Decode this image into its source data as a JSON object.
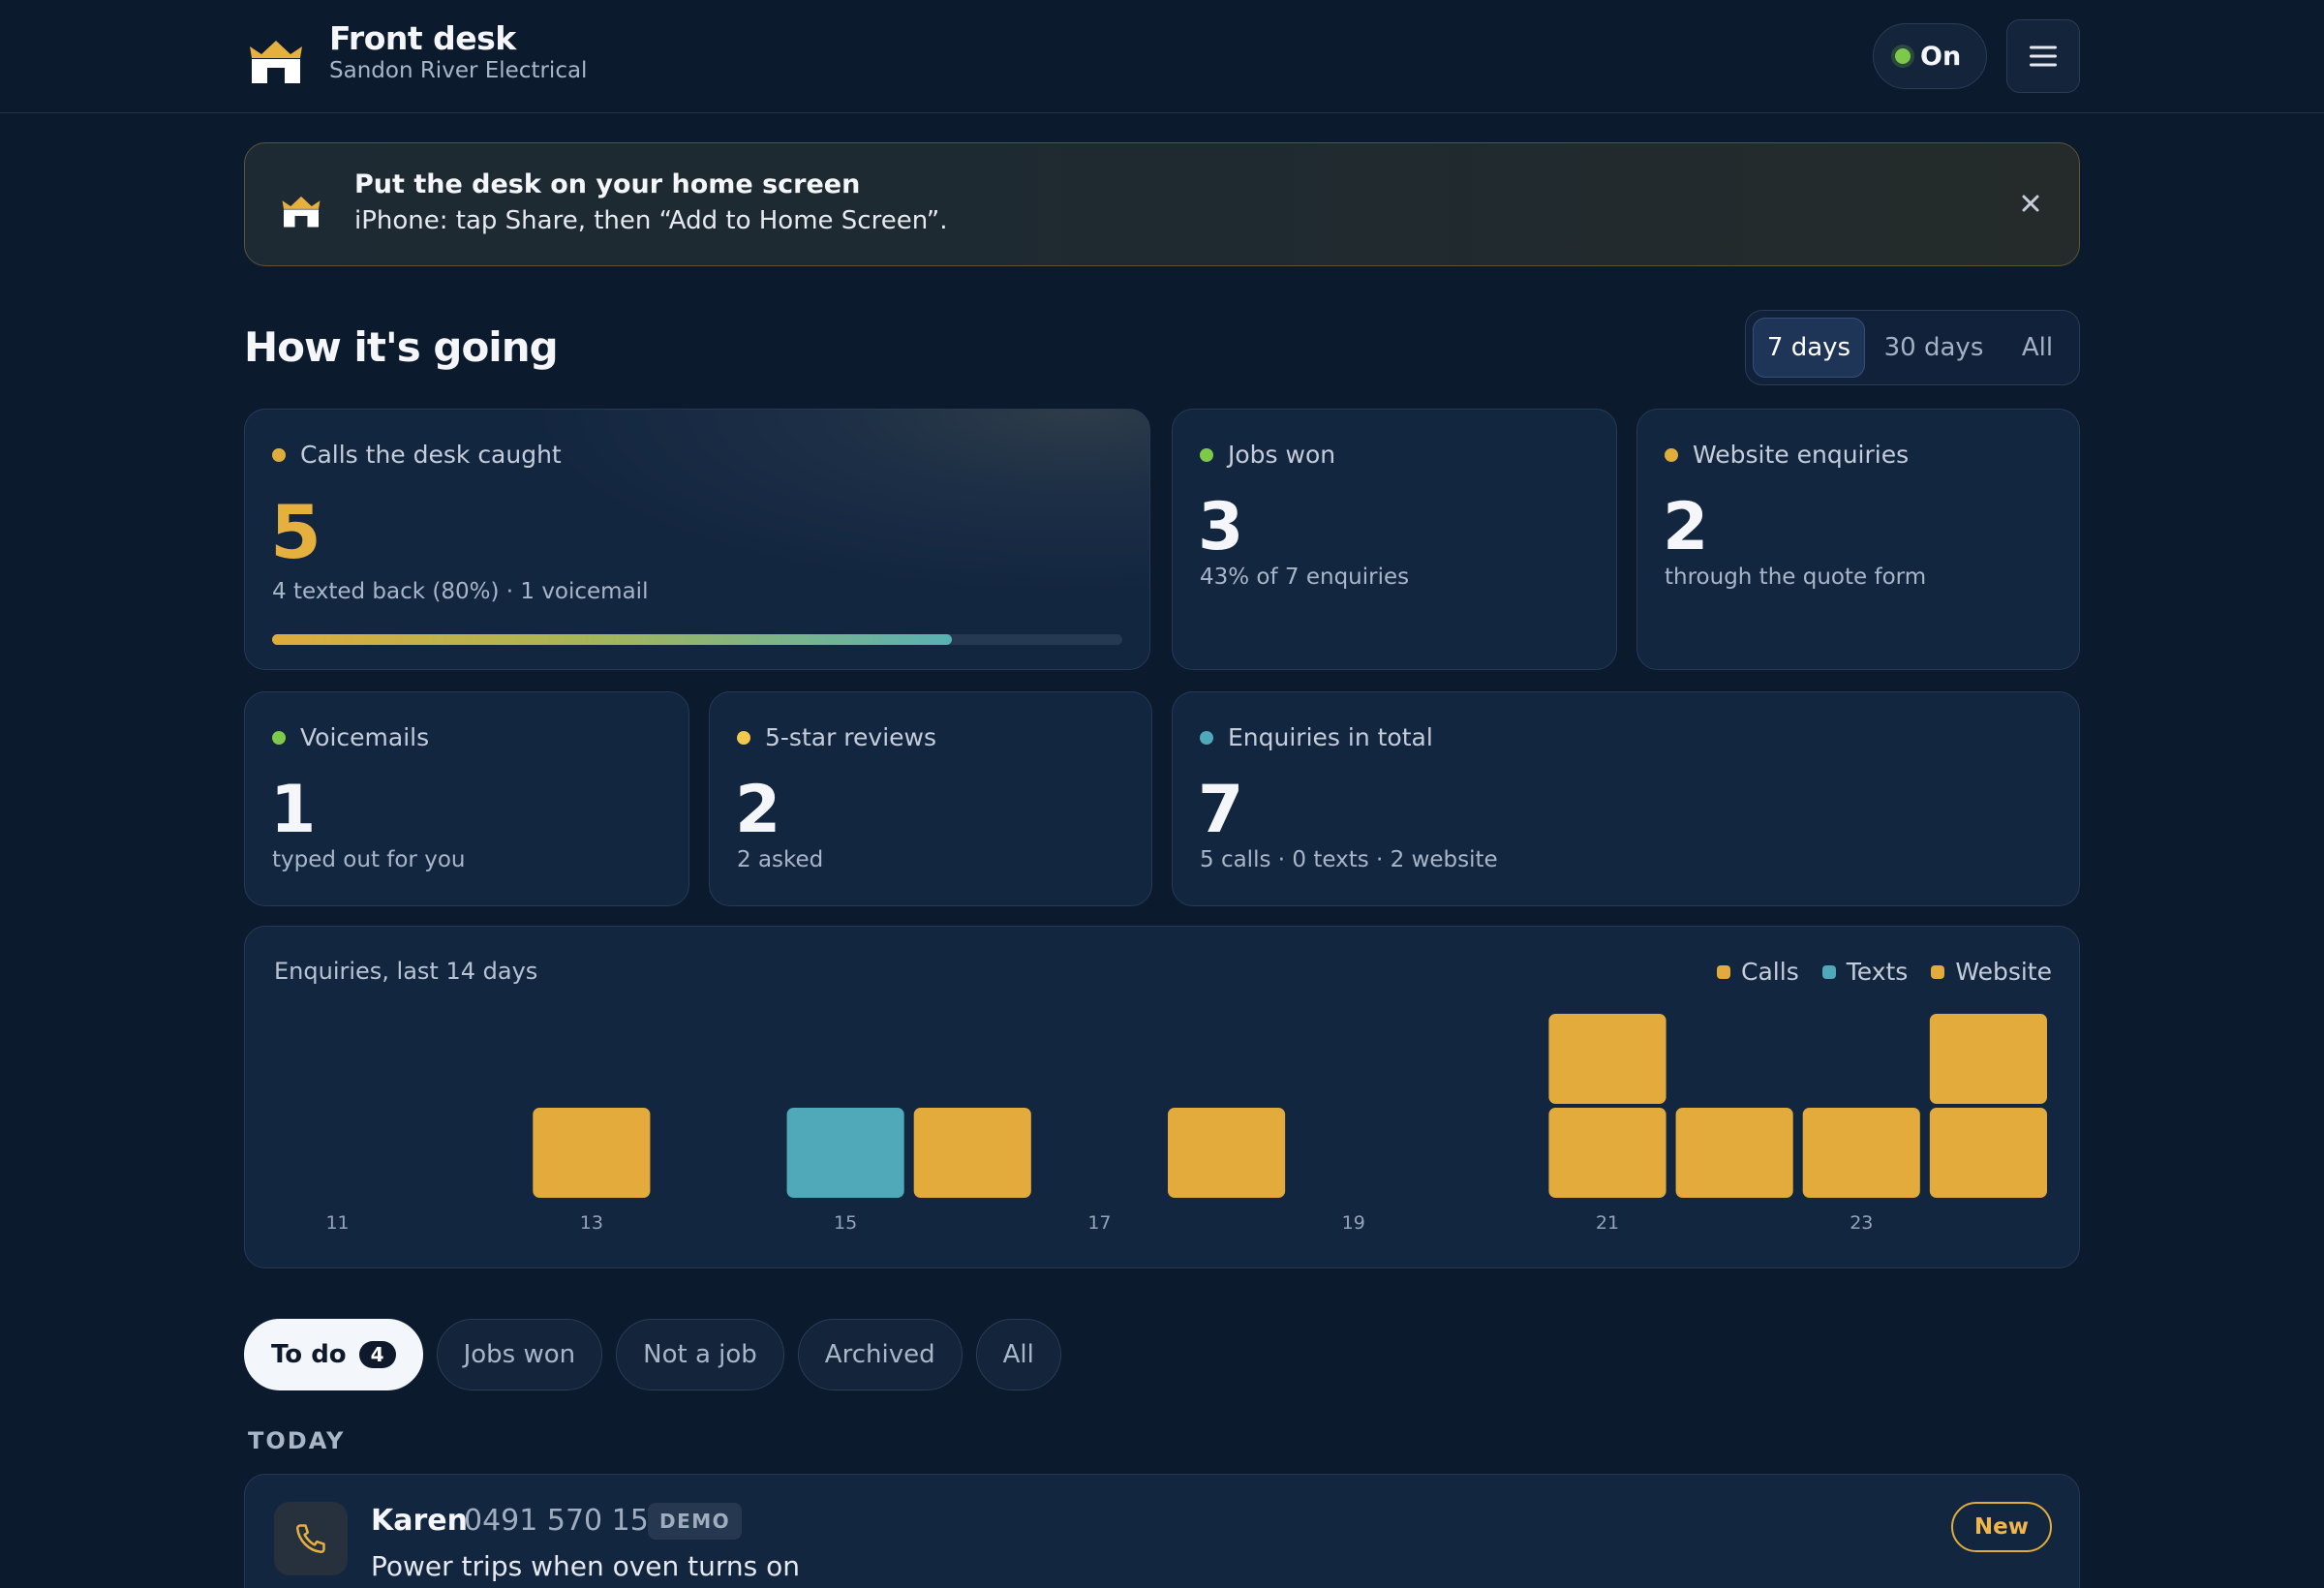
{
  "header": {
    "title": "Front desk",
    "subtitle": "Sandon River Electrical",
    "toggle_label": "On",
    "logo_icon": "house-crown-icon",
    "menu_icon": "hamburger-menu-icon"
  },
  "banner": {
    "title": "Put the desk on your home screen",
    "message": "iPhone: tap Share, then “Add to Home Screen”.",
    "close_icon": "close-icon"
  },
  "stats_section": {
    "title": "How it's going",
    "ranges": [
      "7 days",
      "30 days",
      "All"
    ],
    "selected_range": "7 days"
  },
  "cards": {
    "calls": {
      "label": "Calls the desk caught",
      "value": "5",
      "detail": "4 texted back (80%) · 1 voicemail",
      "progress_percent": 80,
      "dot_color": "#e0ac3c",
      "value_color": "#e6b03f"
    },
    "jobs": {
      "label": "Jobs won",
      "value": "3",
      "detail": "43% of 7 enquiries",
      "dot_color": "#7fc94a"
    },
    "website": {
      "label": "Website enquiries",
      "value": "2",
      "detail": "through the quote form",
      "dot_color": "#e0ac3c"
    },
    "voicemails": {
      "label": "Voicemails",
      "value": "1",
      "detail": "typed out for you",
      "dot_color": "#7fc94a"
    },
    "reviews": {
      "label": "5-star reviews",
      "value": "2",
      "detail": "2 asked",
      "dot_color": "#f2c94c"
    },
    "total": {
      "label": "Enquiries in total",
      "value": "7",
      "detail": "5 calls · 0 texts · 2 website",
      "dot_color": "#4fa9b8"
    }
  },
  "chart_data": {
    "type": "bar",
    "stacked": true,
    "title": "Enquiries, last 14 days",
    "categories": [
      "11",
      "12",
      "13",
      "14",
      "15",
      "16",
      "17",
      "18",
      "19",
      "20",
      "21",
      "22",
      "23",
      "24"
    ],
    "tick_labels": [
      "11",
      "13",
      "15",
      "17",
      "19",
      "21",
      "23"
    ],
    "series": [
      {
        "name": "Calls",
        "color": "#e3aa3c",
        "values": [
          0,
          0,
          1,
          0,
          0,
          1,
          0,
          1,
          0,
          0,
          1,
          1,
          1,
          1
        ]
      },
      {
        "name": "Texts",
        "color": "#4fa9b8",
        "values": [
          0,
          0,
          0,
          0,
          1,
          0,
          0,
          0,
          0,
          0,
          0,
          0,
          0,
          0
        ]
      },
      {
        "name": "Website",
        "color": "#e3aa3c",
        "values": [
          0,
          0,
          0,
          0,
          0,
          0,
          0,
          0,
          0,
          0,
          1,
          0,
          0,
          1
        ]
      }
    ],
    "ylim": [
      0,
      2
    ],
    "grid": false,
    "legend": "top-right"
  },
  "filters": {
    "tabs": [
      {
        "label": "To do",
        "count": "4",
        "active": true
      },
      {
        "label": "Jobs won"
      },
      {
        "label": "Not a job"
      },
      {
        "label": "Archived"
      },
      {
        "label": "All"
      }
    ]
  },
  "list": {
    "group_label": "TODAY",
    "items": [
      {
        "name": "Karen",
        "phone": "0491 570 156",
        "tag": "DEMO",
        "description": "Power trips when oven turns on",
        "status": "New",
        "icon": "phone-icon"
      }
    ]
  }
}
